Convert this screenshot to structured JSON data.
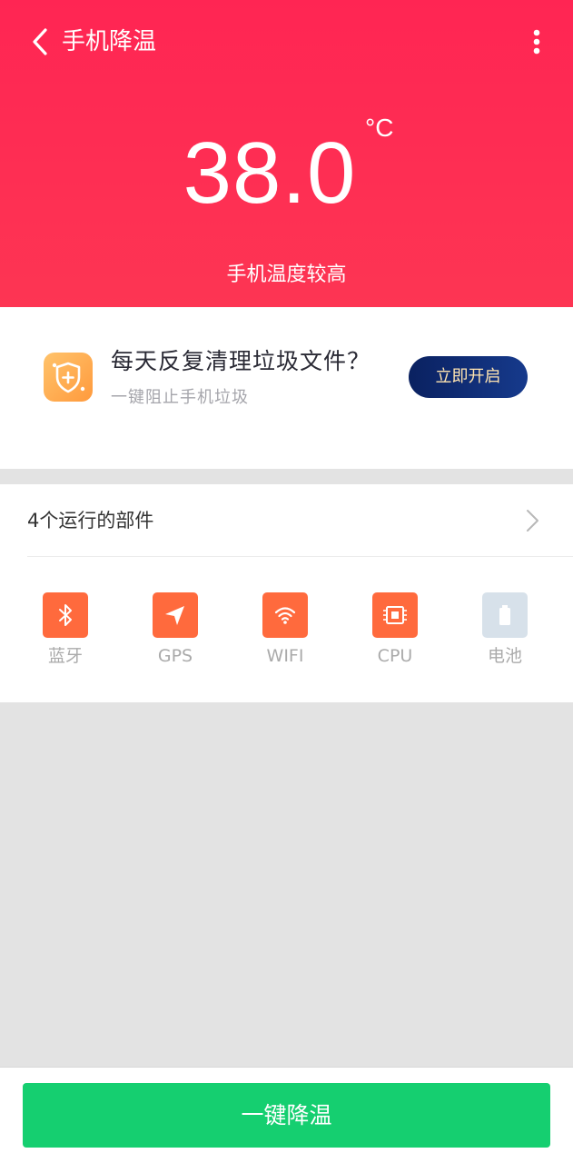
{
  "header": {
    "title": "手机降温",
    "temperature": "38.0",
    "unit": "°C",
    "status": "手机温度较高",
    "background_color": "#ff2d55",
    "back_icon": "chevron-left-icon",
    "more_icon": "more-vertical-icon"
  },
  "promo": {
    "icon": "shield-clean-icon",
    "title": "每天反复清理垃圾文件？",
    "subtitle": "一键阻止手机垃圾",
    "button_label": "立即开启",
    "button_color": "#0b2a6c"
  },
  "components": {
    "title": "4个运行的部件",
    "items": [
      {
        "label": "蓝牙",
        "icon": "bluetooth-icon",
        "active": true,
        "color": "#ff6a3d"
      },
      {
        "label": "GPS",
        "icon": "location-arrow-icon",
        "active": true,
        "color": "#ff6a3d"
      },
      {
        "label": "WIFI",
        "icon": "wifi-icon",
        "active": true,
        "color": "#ff6a3d"
      },
      {
        "label": "CPU",
        "icon": "cpu-chip-icon",
        "active": true,
        "color": "#ff6a3d"
      },
      {
        "label": "电池",
        "icon": "battery-icon",
        "active": false,
        "color": "#d7e1ea"
      }
    ]
  },
  "footer": {
    "button_label": "一键降温",
    "button_color": "#15cf70"
  }
}
